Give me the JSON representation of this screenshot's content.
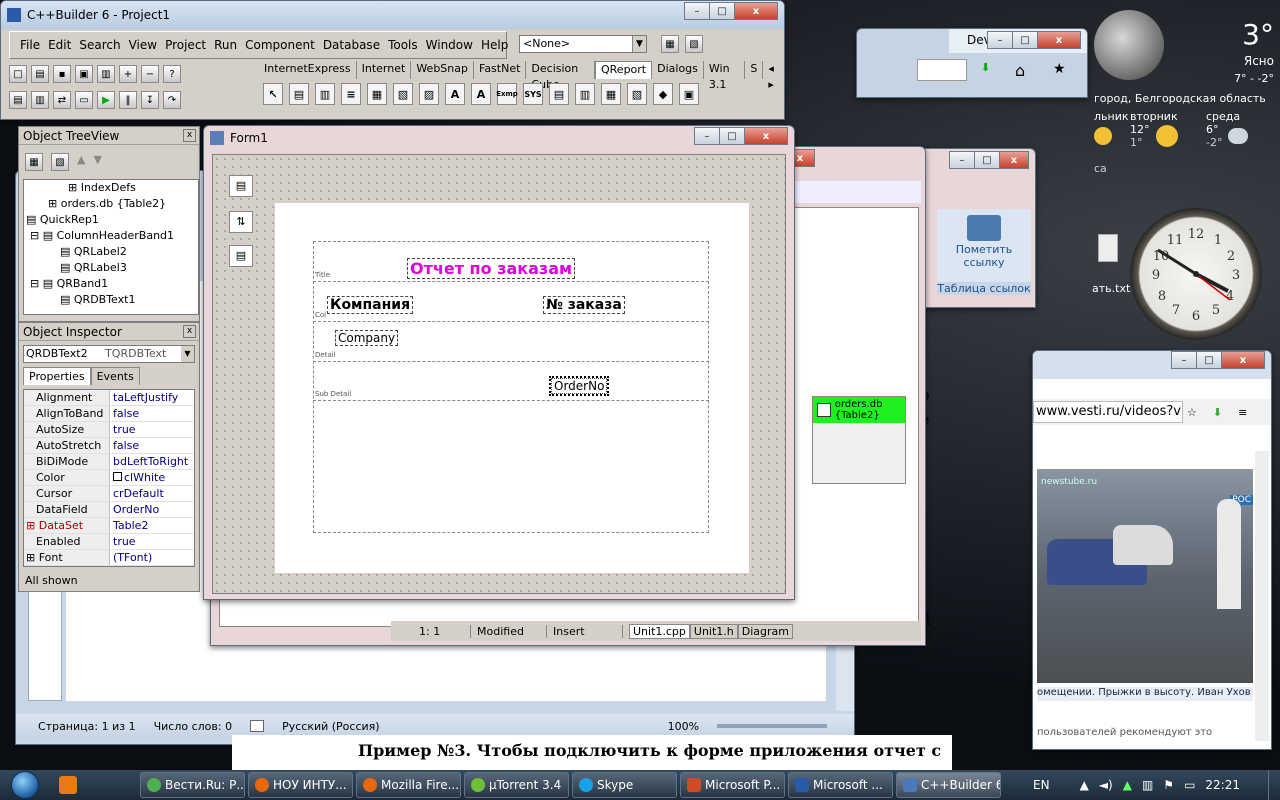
{
  "ide": {
    "title": "C++Builder 6 - Project1",
    "menu": [
      "File",
      "Edit",
      "Search",
      "View",
      "Project",
      "Run",
      "Component",
      "Database",
      "Tools",
      "Window",
      "Help"
    ],
    "combo_value": "<None>",
    "palette_tabs": [
      "InternetExpress",
      "Internet",
      "WebSnap",
      "FastNet",
      "Decision Cube",
      "QReport",
      "Dialogs",
      "Win 3.1",
      "S"
    ],
    "active_tab": "QReport",
    "palette_icons": [
      "SYS",
      "Exmp"
    ]
  },
  "treeview": {
    "title": "Object TreeView",
    "items": [
      "IndexDefs",
      "orders.db {Table2}",
      "QuickRep1",
      "ColumnHeaderBand1",
      "QRLabel2",
      "QRLabel3",
      "QRBand1",
      "QRDBText1",
      "QRSubDetail1"
    ]
  },
  "inspector": {
    "title": "Object Inspector",
    "selected": "QRDBText2",
    "selected_type": "TQRDBText",
    "tabs": [
      "Properties",
      "Events"
    ],
    "props": [
      {
        "name": "Alignment",
        "value": "taLeftJustify"
      },
      {
        "name": "AlignToBand",
        "value": "false"
      },
      {
        "name": "AutoSize",
        "value": "true"
      },
      {
        "name": "AutoStretch",
        "value": "false"
      },
      {
        "name": "BiDiMode",
        "value": "bdLeftToRight"
      },
      {
        "name": "Color",
        "value": "clWhite"
      },
      {
        "name": "Cursor",
        "value": "crDefault"
      },
      {
        "name": "DataField",
        "value": "OrderNo"
      },
      {
        "name": "DataSet",
        "value": "Table2"
      },
      {
        "name": "Enabled",
        "value": "true"
      },
      {
        "name": "Font",
        "value": "(TFont)"
      }
    ],
    "status": "All shown"
  },
  "form": {
    "title": "Form1",
    "report_title": "Отчет по заказам",
    "col1": "Компания",
    "col2": "№ заказа",
    "field1": "Company",
    "field2": "OrderNo",
    "band_title": "Title",
    "band_col": "Col",
    "band_detail": "Detail",
    "band_sub": "Sub Detail",
    "table_comp": "orders.db {Table2}"
  },
  "editor": {
    "status_pos": "1:   1",
    "status_mod": "Modified",
    "status_ins": "Insert",
    "tabs": [
      "Unit1.cpp",
      "Unit1.h",
      "Diagram"
    ]
  },
  "word": {
    "status_page": "Страница: 1 из 1",
    "status_words": "Число слов: 0",
    "status_lang": "Русский (Россия)",
    "zoom": "100%",
    "ribbon_btn": "Пометить ссылку",
    "ribbon_group": "Таблица ссылок",
    "ruler_num": "17",
    "doc_text": "Пример №3. Чтобы подключить к форме приложения отчет с",
    "side_letters": [
      "о",
      "е",
      "d"
    ]
  },
  "browser": {
    "tab_device": "Device(IP",
    "url": "www.vesti.ru/videos?v",
    "video_caption": "омещении. Прыжки в высоту. Иван Ухов (РФ) - с",
    "below": "пользователей рекомендуют это",
    "logo": "newstube.ru",
    "ross": "РОС"
  },
  "weather": {
    "temp": "3°",
    "cond": "Ясно",
    "range": "7° - -2°",
    "city": "город, Белгородская область",
    "days": [
      {
        "name": "льник",
        "hi": "",
        "lo": ""
      },
      {
        "name": "вторник",
        "hi": "12°",
        "lo": "1°"
      },
      {
        "name": "среда",
        "hi": "6°",
        "lo": "-2°"
      }
    ],
    "source": "са"
  },
  "desktop_file": "ать.txt",
  "taskbar": {
    "items": [
      "Вести.Ru: Р...",
      "НОУ ИНТУ...",
      "Mozilla Fire...",
      "µTorrent 3.4",
      "Skype",
      "Microsoft P...",
      "Microsoft ...",
      "C++Builder 6"
    ],
    "lang": "EN",
    "time": "22:21"
  }
}
